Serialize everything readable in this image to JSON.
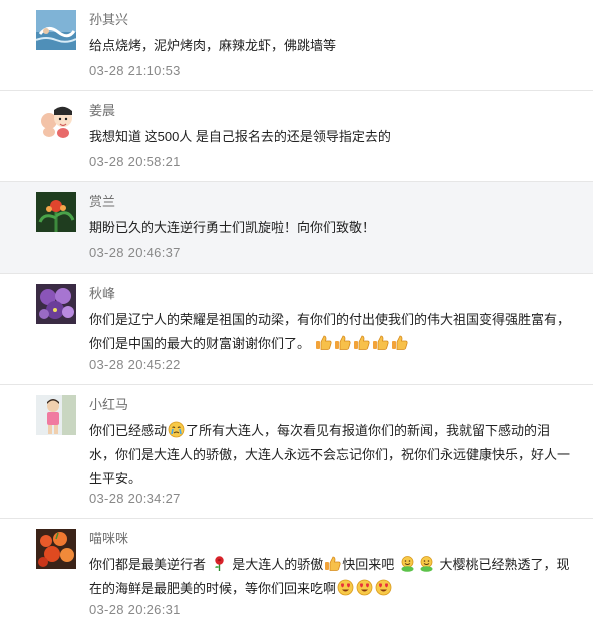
{
  "comments": [
    {
      "name": "孙其兴",
      "text": "给点烧烤，泥炉烤肉，麻辣龙虾，佛跳墙等",
      "time": "03-28 21:10:53"
    },
    {
      "name": "姜晨",
      "text": "我想知道 这500人 是自己报名去的还是领导指定去的",
      "time": "03-28 20:58:21"
    },
    {
      "name": "赏兰",
      "text": "期盼已久的大连逆行勇士们凯旋啦！向你们致敬！",
      "time": "03-28 20:46:37"
    },
    {
      "name": "秋峰",
      "text_a": "你们是辽宁人的荣耀是祖国的动梁，有你们的付出使我们的伟大祖国变得强胜富有，你们是中国的最大的财富谢谢你们了。",
      "time": "03-28 20:45:22"
    },
    {
      "name": "小红马",
      "text_a": "你们已经感动",
      "text_b": "了所有大连人，每次看见有报道你们的新闻，我就留下感动的泪水，你们是大连人的骄傲，大连人永远不会忘记你们，祝你们永远健康快乐，好人一生平安。",
      "time": "03-28 20:34:27"
    },
    {
      "name": "喵咪咪",
      "text_a": "你们都是最美逆行者",
      "text_b": "是大连人的骄傲",
      "text_c": "快回来吧",
      "text_d": "大樱桃已经熟透了，现在的海鲜是最肥美的时候，等你们回来吃啊",
      "time": "03-28 20:26:31"
    }
  ]
}
